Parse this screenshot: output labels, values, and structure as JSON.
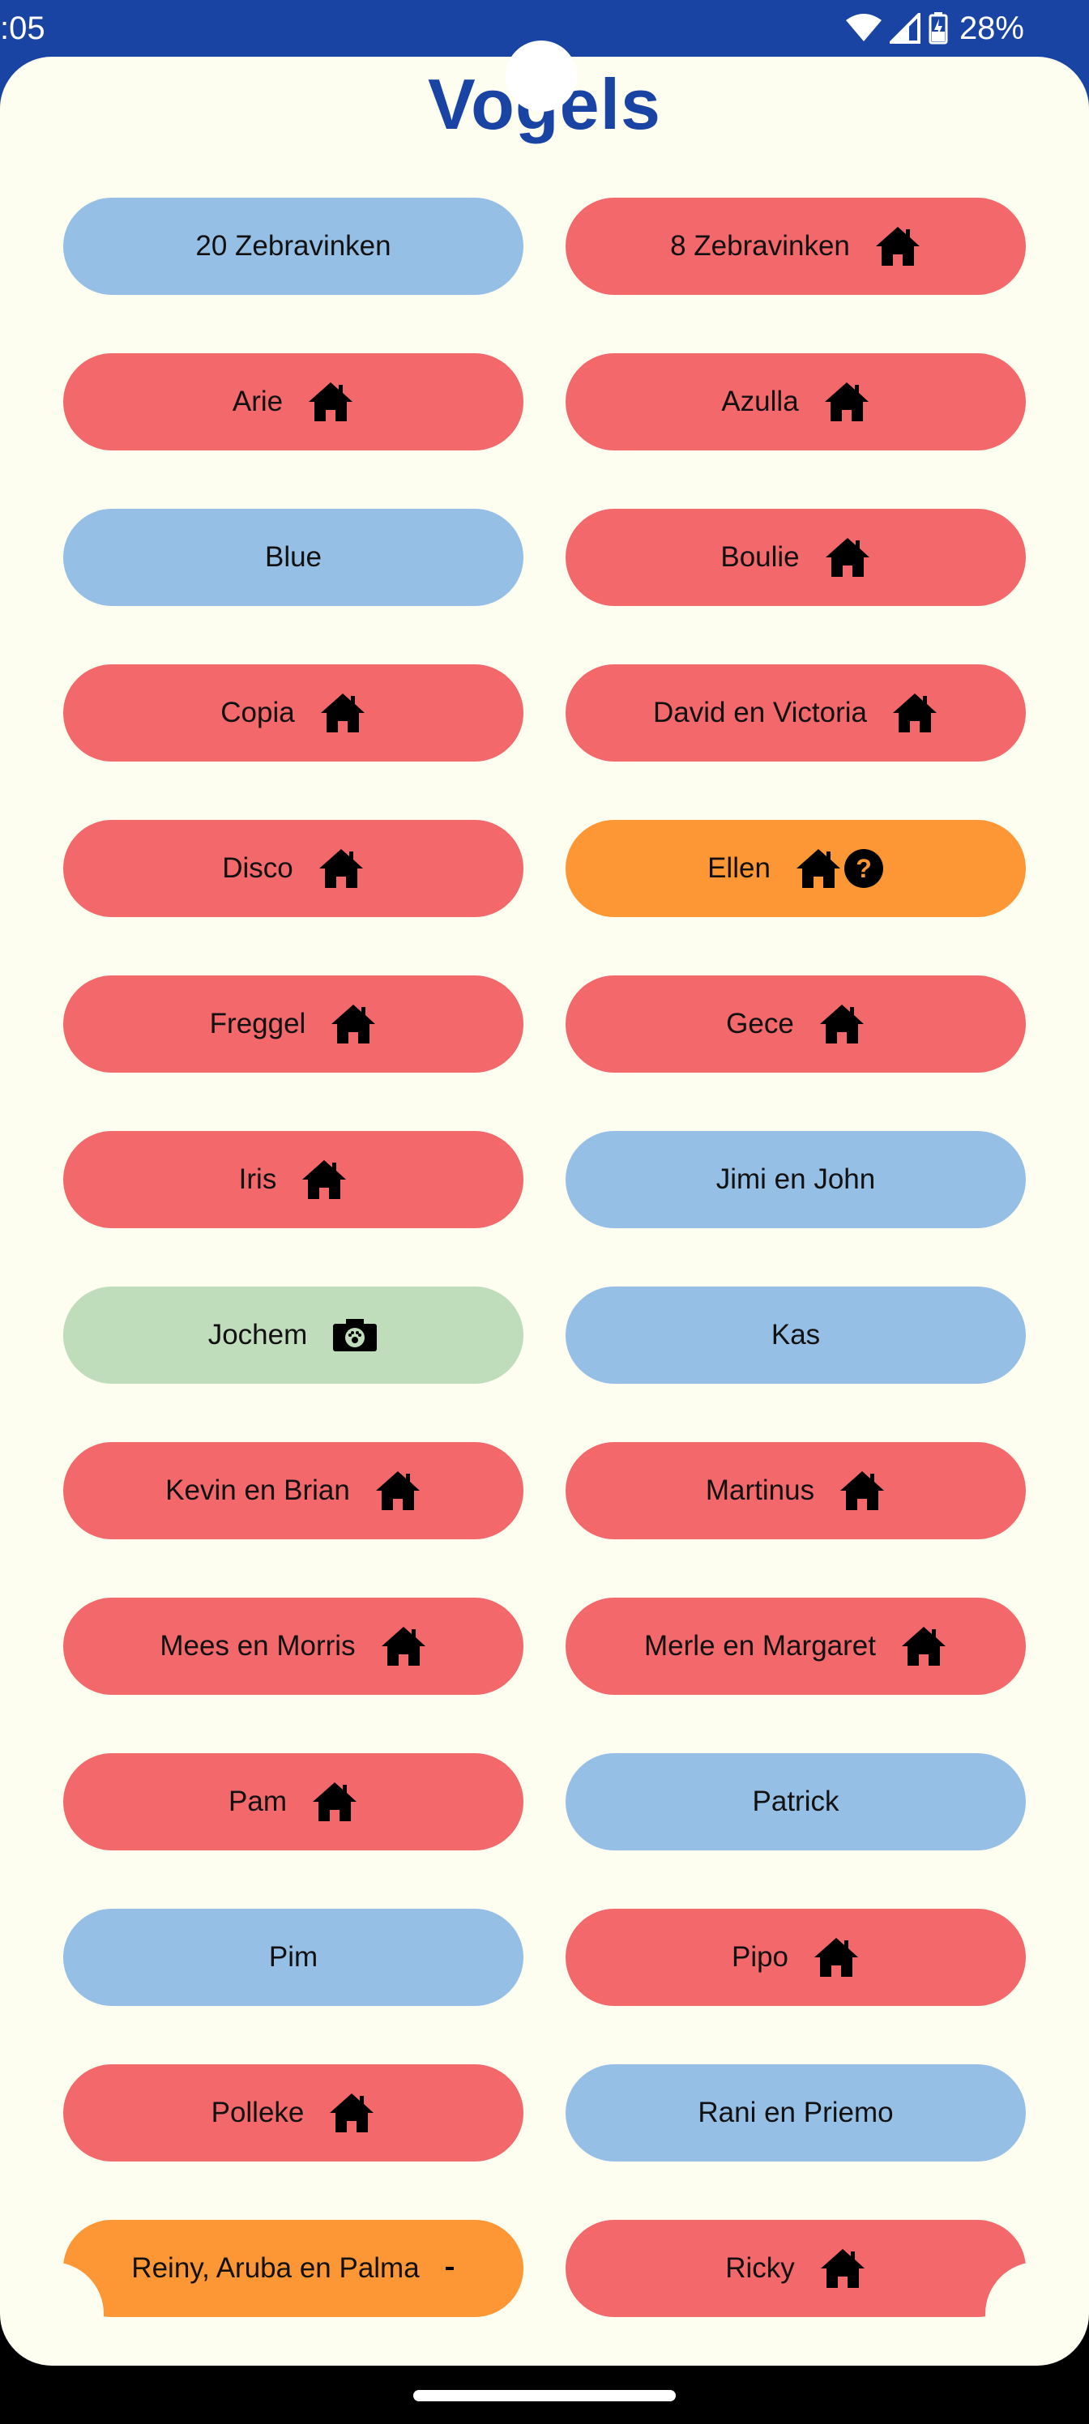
{
  "status_bar": {
    "time": ":05",
    "battery_percent": "28%",
    "icons": [
      "wifi-icon",
      "cell-signal-icon",
      "battery-charging-icon"
    ]
  },
  "page": {
    "title": "Vogels"
  },
  "colors": {
    "header_blue": "#1a44a4",
    "background": "#fdfdf0",
    "red": "#f2686b",
    "blue": "#96bfe6",
    "orange": "#fd9735",
    "green": "#bfdcbb"
  },
  "birds": [
    {
      "label": "20 Zebravinken",
      "color": "blue",
      "icons": []
    },
    {
      "label": "8 Zebravinken",
      "color": "red",
      "icons": [
        "home-icon"
      ]
    },
    {
      "label": "Arie",
      "color": "red",
      "icons": [
        "home-icon"
      ]
    },
    {
      "label": "Azulla",
      "color": "red",
      "icons": [
        "home-icon"
      ]
    },
    {
      "label": "Blue",
      "color": "blue",
      "icons": []
    },
    {
      "label": "Boulie",
      "color": "red",
      "icons": [
        "home-icon"
      ]
    },
    {
      "label": "Copia",
      "color": "red",
      "icons": [
        "home-icon"
      ]
    },
    {
      "label": "David en Victoria",
      "color": "red",
      "icons": [
        "home-icon"
      ]
    },
    {
      "label": "Disco",
      "color": "red",
      "icons": [
        "home-icon"
      ]
    },
    {
      "label": "Ellen",
      "color": "orange",
      "icons": [
        "home-icon",
        "question-icon"
      ]
    },
    {
      "label": "Freggel",
      "color": "red",
      "icons": [
        "home-icon"
      ]
    },
    {
      "label": "Gece",
      "color": "red",
      "icons": [
        "home-icon"
      ]
    },
    {
      "label": "Iris",
      "color": "red",
      "icons": [
        "home-icon"
      ]
    },
    {
      "label": "Jimi en John",
      "color": "blue",
      "icons": []
    },
    {
      "label": "Jochem",
      "color": "green",
      "icons": [
        "pet-camera-icon"
      ]
    },
    {
      "label": "Kas",
      "color": "blue",
      "icons": []
    },
    {
      "label": "Kevin en Brian",
      "color": "red",
      "icons": [
        "home-icon"
      ]
    },
    {
      "label": "Martinus",
      "color": "red",
      "icons": [
        "home-icon"
      ]
    },
    {
      "label": "Mees en Morris",
      "color": "red",
      "icons": [
        "home-icon"
      ]
    },
    {
      "label": "Merle en Margaret",
      "color": "red",
      "icons": [
        "home-icon"
      ]
    },
    {
      "label": "Pam",
      "color": "red",
      "icons": [
        "home-icon"
      ]
    },
    {
      "label": "Patrick",
      "color": "blue",
      "icons": []
    },
    {
      "label": "Pim",
      "color": "blue",
      "icons": []
    },
    {
      "label": "Pipo",
      "color": "red",
      "icons": [
        "home-icon"
      ]
    },
    {
      "label": "Polleke",
      "color": "red",
      "icons": [
        "home-icon"
      ]
    },
    {
      "label": "Rani en Priemo",
      "color": "blue",
      "icons": []
    },
    {
      "label": "Reiny, Aruba en Palma",
      "color": "orange",
      "icons": [
        "dash-icon"
      ]
    },
    {
      "label": "Ricky",
      "color": "red",
      "icons": [
        "home-icon"
      ]
    }
  ]
}
